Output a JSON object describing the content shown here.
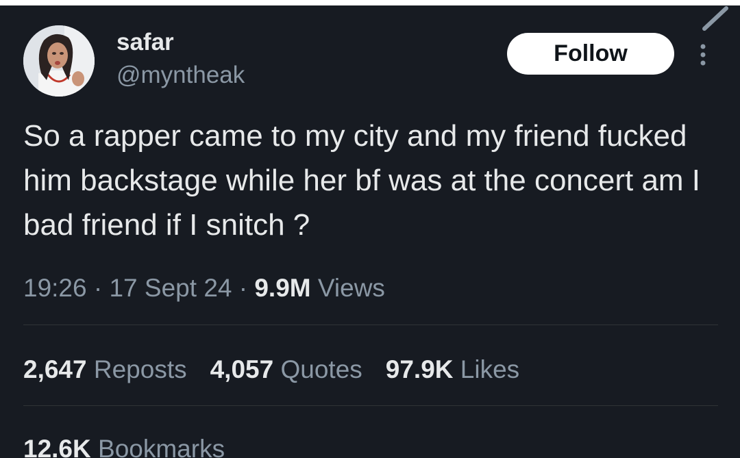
{
  "user": {
    "name": "safar",
    "handle": "@myntheak"
  },
  "actions": {
    "follow_label": "Follow"
  },
  "tweet": {
    "text": "So a rapper came to my city and my friend fucked him backstage while her bf was at the concert am I bad friend if I snitch ?",
    "time": "19:26",
    "separator": "·",
    "date": "17 Sept 24",
    "views_count": "9.9M",
    "views_label": "Views"
  },
  "stats": {
    "reposts": {
      "count": "2,647",
      "label": "Reposts"
    },
    "quotes": {
      "count": "4,057",
      "label": "Quotes"
    },
    "likes": {
      "count": "97.9K",
      "label": "Likes"
    },
    "bookmarks": {
      "count": "12.6K",
      "label": "Bookmarks"
    }
  },
  "icons": {
    "more": "more-vertical-icon",
    "edit": "pencil-icon"
  },
  "colors": {
    "background": "#171b22",
    "text_primary": "#e7e9ea",
    "text_secondary": "#8b98a5",
    "divider": "#2f3336",
    "follow_bg": "#ffffff",
    "follow_text": "#0f1419"
  }
}
